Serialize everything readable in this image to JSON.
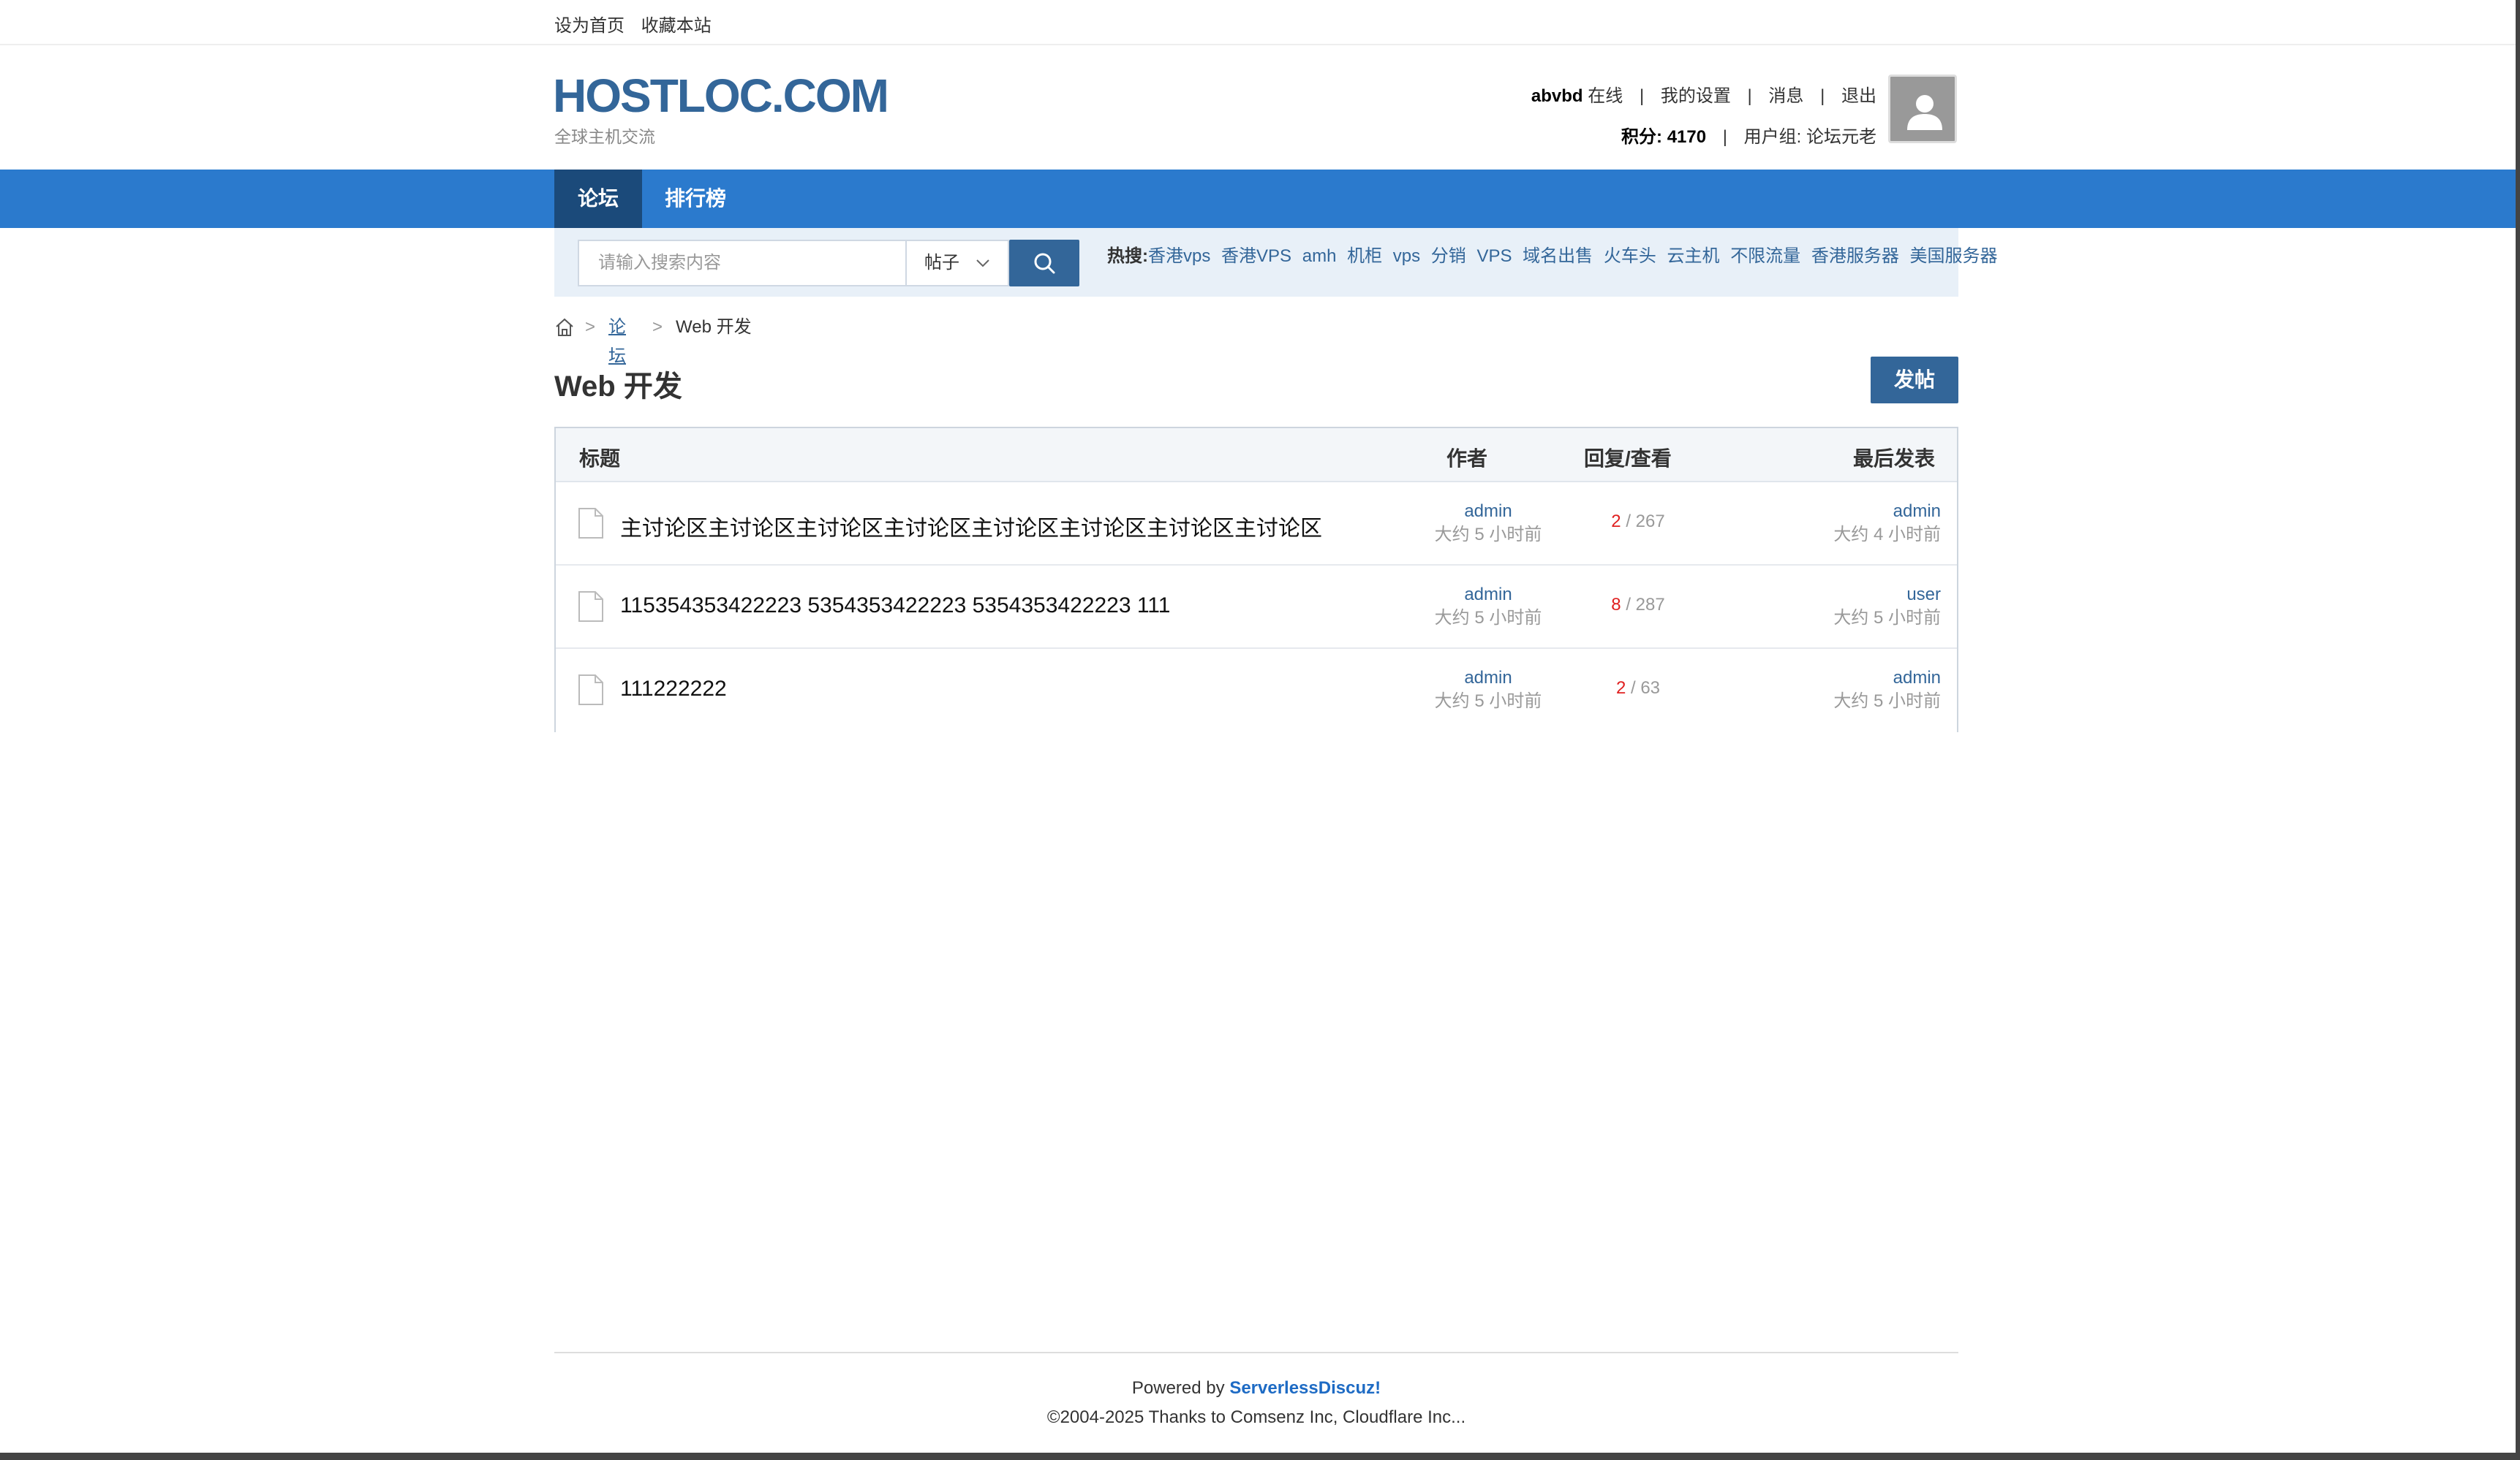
{
  "topbar": {
    "set_home": "设为首页",
    "bookmark": "收藏本站"
  },
  "header": {
    "logo": "HOSTLOC.COM",
    "tagline": "全球主机交流",
    "user": {
      "username": "abvbd",
      "status": "在线",
      "settings": "我的设置",
      "messages": "消息",
      "logout": "退出",
      "points_label": "积分:",
      "points_value": "4170",
      "group_label": "用户组:",
      "group_value": "论坛元老",
      "separator": "|"
    }
  },
  "nav": {
    "forum": "论坛",
    "ranking": "排行榜"
  },
  "search": {
    "placeholder": "请输入搜索内容",
    "type": "帖子",
    "hot_label": "热搜:",
    "hot_terms": [
      "香港vps",
      "香港VPS",
      "amh",
      "机柜",
      "vps",
      "分销",
      "VPS",
      "域名出售",
      "火车头",
      "云主机",
      "不限流量",
      "香港服务器",
      "美国服务器"
    ]
  },
  "breadcrumb": {
    "forum": "论坛",
    "current": "Web 开发",
    "sep": ">"
  },
  "forum": {
    "title": "Web 开发",
    "post_button": "发帖"
  },
  "table": {
    "headers": {
      "title": "标题",
      "author": "作者",
      "replies_views": "回复/查看",
      "last_post": "最后发表"
    },
    "rows": [
      {
        "title": "主讨论区主讨论区主讨论区主讨论区主讨论区主讨论区主讨论区主讨论区",
        "author": "admin",
        "author_time": "大约 5 小时前",
        "replies": "2",
        "views": "267",
        "last_user": "admin",
        "last_time": "大约 4 小时前"
      },
      {
        "title": "115354353422223 5354353422223 5354353422223 111",
        "author": "admin",
        "author_time": "大约 5 小时前",
        "replies": "8",
        "views": "287",
        "last_user": "user",
        "last_time": "大约 5 小时前"
      },
      {
        "title": "111222222",
        "author": "admin",
        "author_time": "大约 5 小时前",
        "replies": "2",
        "views": "63",
        "last_user": "admin",
        "last_time": "大约 5 小时前"
      }
    ],
    "slash": "/"
  },
  "footer": {
    "powered_prefix": "Powered by",
    "powered_name": "ServerlessDiscuz!",
    "copyright": "©2004-2025 Thanks to Comsenz Inc, Cloudflare Inc..."
  }
}
